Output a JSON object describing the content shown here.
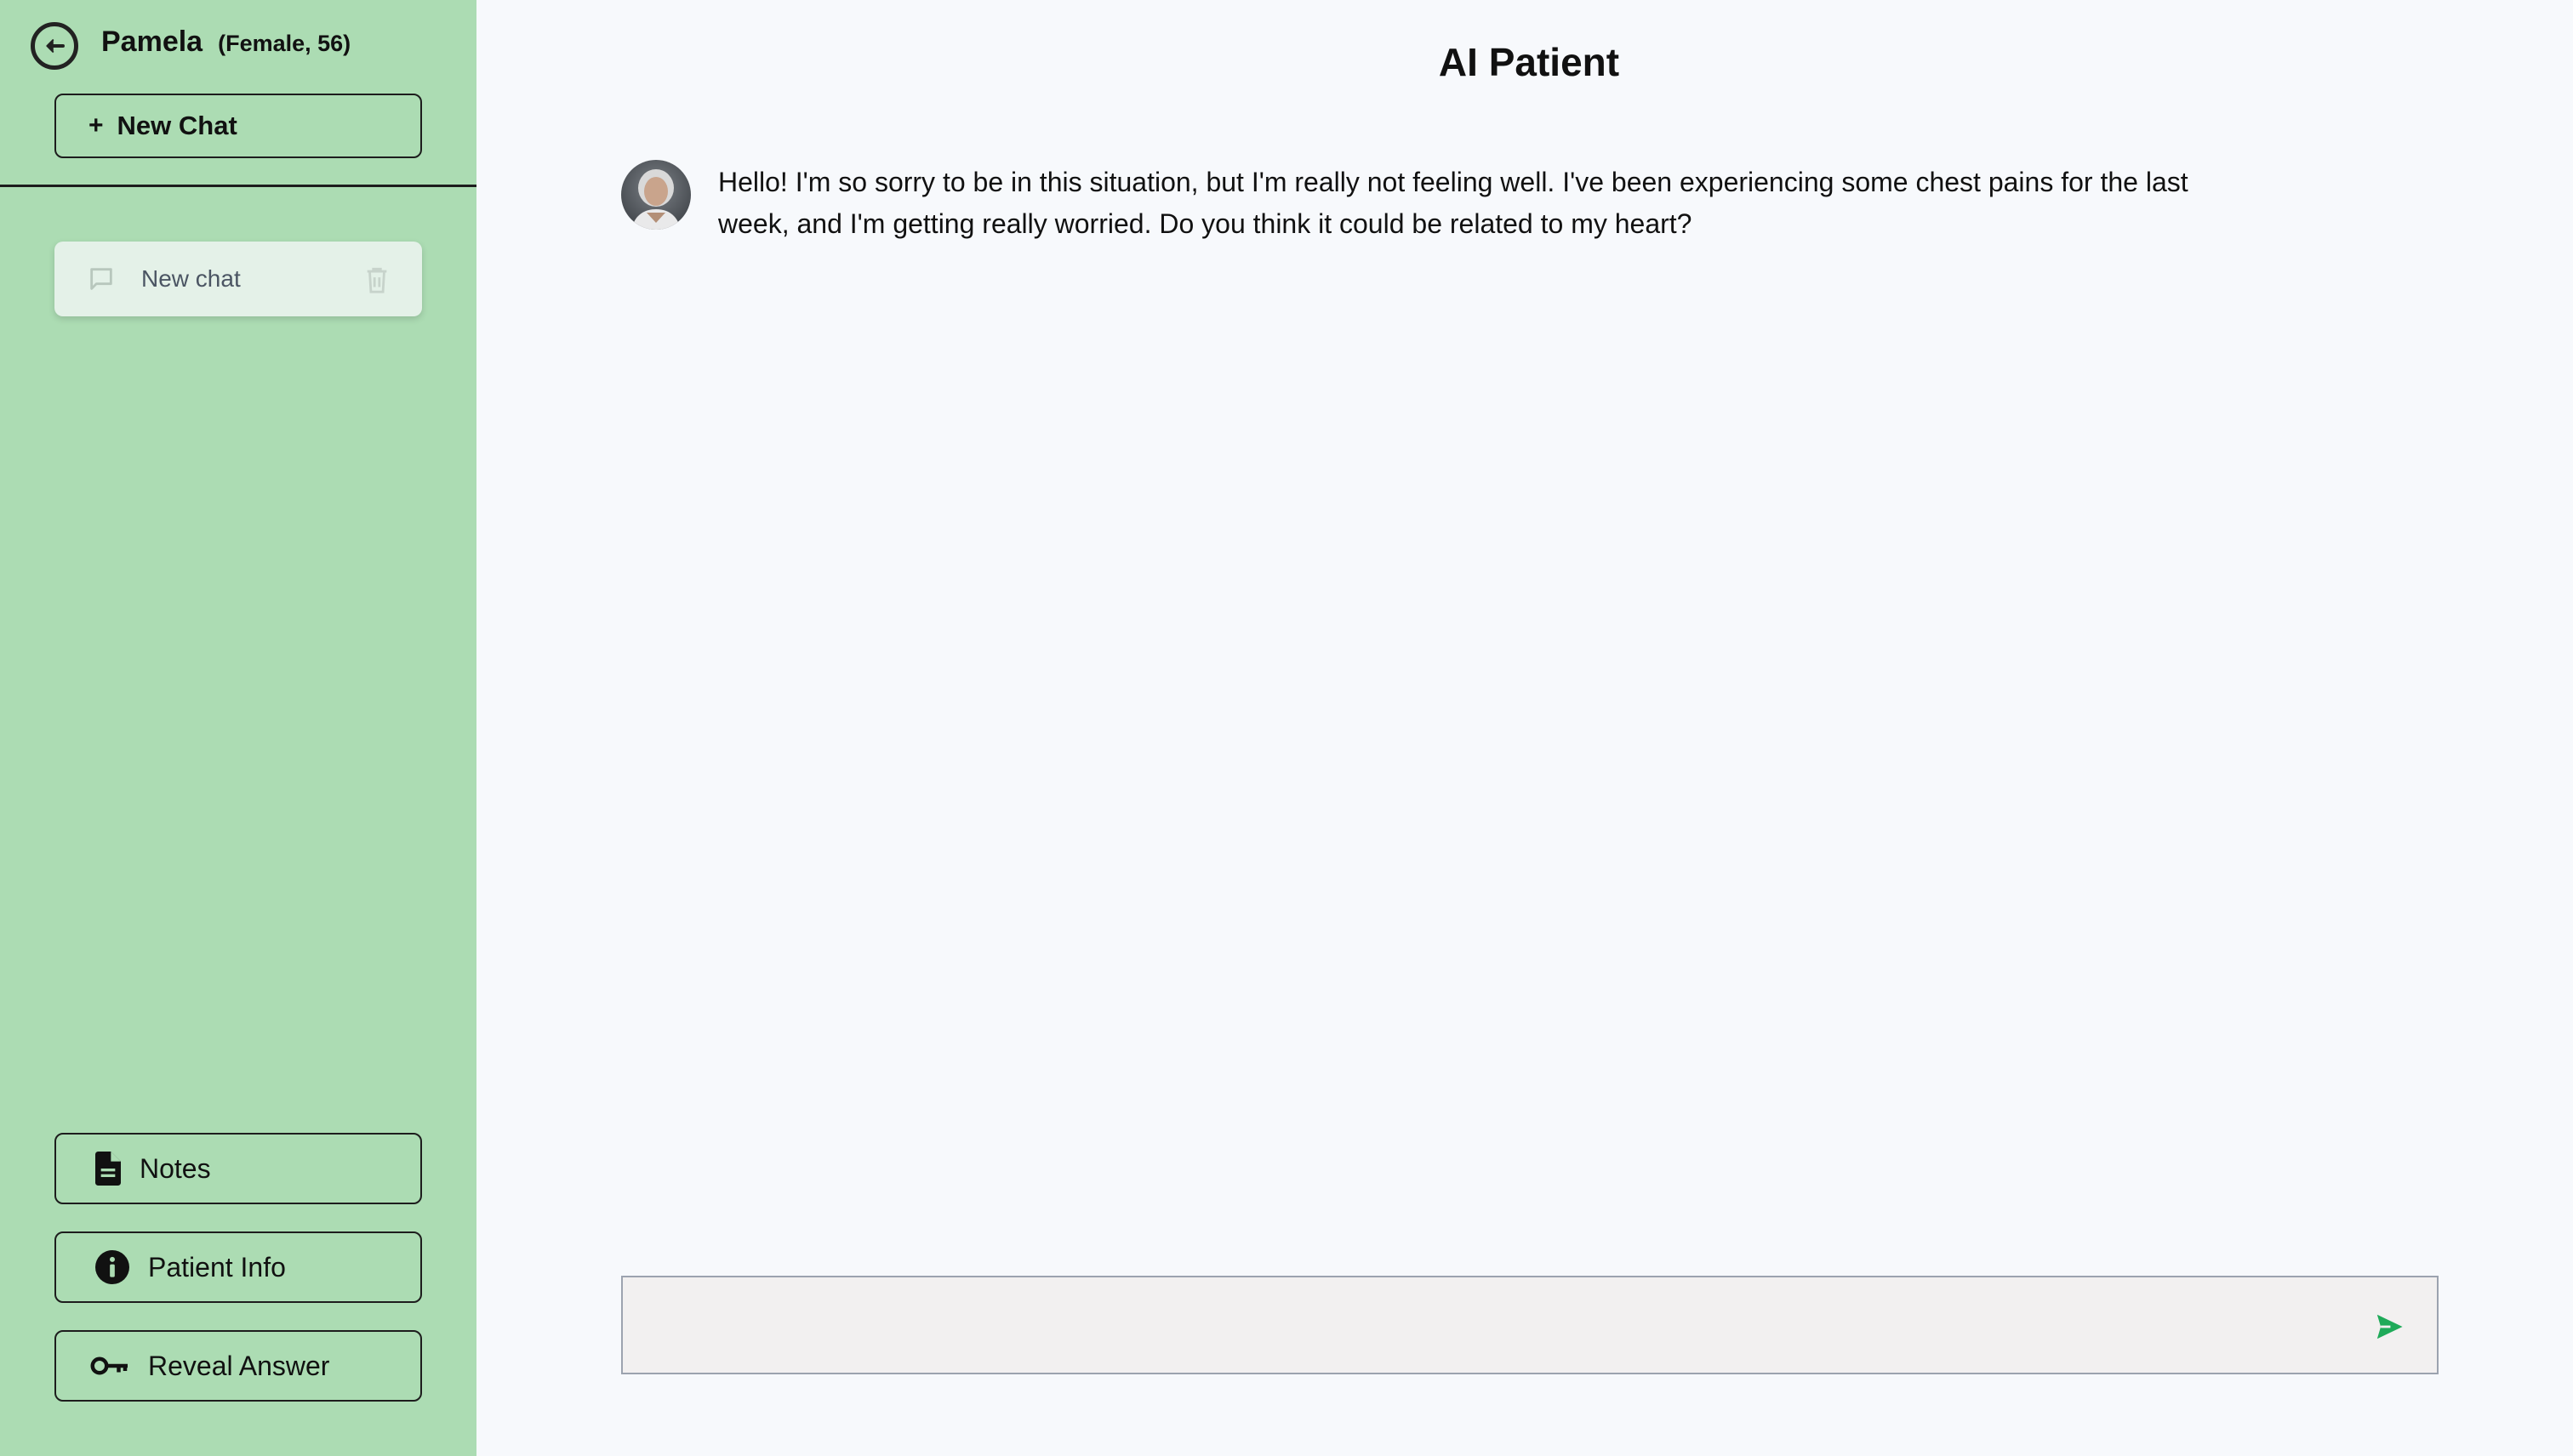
{
  "sidebar": {
    "patient_name": "Pamela",
    "patient_meta": "(Female, 56)",
    "new_chat_plus": "+",
    "new_chat_label": "New Chat",
    "chats": [
      {
        "label": "New chat"
      }
    ],
    "notes_label": "Notes",
    "patient_info_label": "Patient Info",
    "reveal_answer_label": "Reveal Answer"
  },
  "main": {
    "title": "AI Patient",
    "messages": [
      {
        "role": "patient",
        "text": "Hello! I'm so sorry to be in this situation, but I'm really not feeling well. I've been experiencing some chest pains for the last week, and I'm getting really worried. Do you think it could be related to my heart?"
      }
    ],
    "composer": {
      "value": "",
      "placeholder": ""
    }
  },
  "colors": {
    "sidebar_bg": "#acdcb3",
    "main_bg": "#f7f9fc",
    "send_accent": "#1faa59",
    "chat_item_bg": "#e4f1e8"
  },
  "icons": {
    "back": "arrow-left-circle-icon",
    "chat": "chat-bubble-icon",
    "delete": "trash-icon",
    "notes": "document-icon",
    "info": "info-circle-icon",
    "reveal": "key-icon",
    "send": "send-icon"
  }
}
